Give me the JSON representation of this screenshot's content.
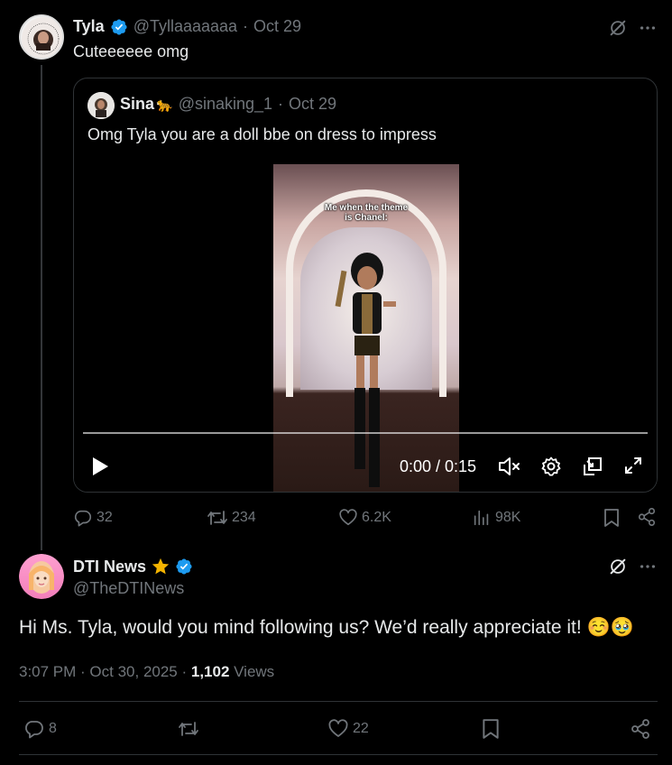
{
  "parent_tweet": {
    "name": "Tyla",
    "handle": "@Tyllaaaaaaa",
    "date": "Oct 29",
    "text": "Cuteeeeee omg",
    "quote": {
      "name": "Sina",
      "emoji": "🐆",
      "handle": "@sinaking_1",
      "date": "Oct 29",
      "text": "Omg Tyla you are a doll bbe on dress to impress",
      "video": {
        "caption": "Me when the theme is Chanel:",
        "time": "0:00 / 0:15"
      }
    },
    "stats": {
      "replies": "32",
      "reposts": "234",
      "likes": "6.2K",
      "views": "98K"
    }
  },
  "reply": {
    "name": "DTI News",
    "handle": "@TheDTINews",
    "text": "Hi Ms. Tyla, would you mind following us? We’d really appreciate it! ☺️🥹",
    "time": "3:07 PM · Oct 30, 2025 · ",
    "views_count": "1,102",
    "views_label": " Views",
    "stats": {
      "replies": "8",
      "likes": "22"
    }
  },
  "colors": {
    "background": "#000000",
    "text": "#e7e9ea",
    "muted": "#71767b",
    "border": "#2f3336",
    "verified": "#1d9bf0",
    "star": "#f4b400"
  },
  "icons": [
    "grok-icon",
    "more-icon",
    "verified-icon",
    "play-icon",
    "mute-icon",
    "settings-icon",
    "pip-icon",
    "fullscreen-icon",
    "reply-icon",
    "repost-icon",
    "like-icon",
    "views-icon",
    "bookmark-icon",
    "share-icon",
    "star-icon"
  ]
}
